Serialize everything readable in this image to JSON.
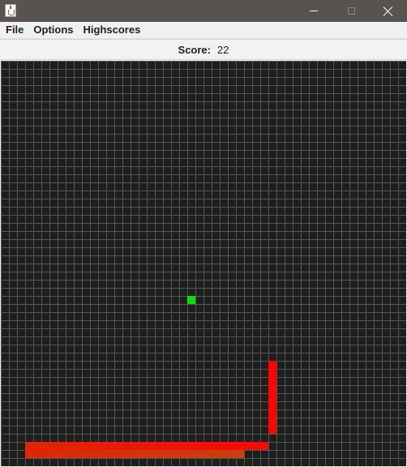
{
  "window": {
    "icon": "java-cup-icon",
    "controls": [
      "minimize-icon",
      "maximize-icon",
      "close-icon"
    ]
  },
  "menu": {
    "items": [
      {
        "label": "File"
      },
      {
        "label": "Options"
      },
      {
        "label": "Highscores"
      }
    ]
  },
  "score": {
    "label": "Score:",
    "value": "22"
  },
  "board": {
    "columns": 50,
    "rows": 50,
    "background_color": "#1e1e1e",
    "grid_color": "#555555",
    "food": {
      "col": 23,
      "row": 29,
      "color": "#00e000"
    },
    "snake": {
      "head_color": "#ff0000",
      "tail_color": "#c9400b",
      "segments": [
        [
          33,
          37
        ],
        [
          33,
          38
        ],
        [
          33,
          39
        ],
        [
          33,
          40
        ],
        [
          33,
          41
        ],
        [
          33,
          42
        ],
        [
          33,
          43
        ],
        [
          33,
          44
        ],
        [
          33,
          45
        ],
        [
          32,
          47
        ],
        [
          31,
          47
        ],
        [
          30,
          47
        ],
        [
          29,
          47
        ],
        [
          28,
          47
        ],
        [
          27,
          47
        ],
        [
          26,
          47
        ],
        [
          25,
          47
        ],
        [
          24,
          47
        ],
        [
          23,
          47
        ],
        [
          22,
          47
        ],
        [
          21,
          47
        ],
        [
          20,
          47
        ],
        [
          19,
          47
        ],
        [
          18,
          47
        ],
        [
          17,
          47
        ],
        [
          16,
          47
        ],
        [
          15,
          47
        ],
        [
          14,
          47
        ],
        [
          13,
          47
        ],
        [
          12,
          47
        ],
        [
          11,
          47
        ],
        [
          10,
          47
        ],
        [
          9,
          47
        ],
        [
          8,
          47
        ],
        [
          7,
          47
        ],
        [
          6,
          47
        ],
        [
          5,
          47
        ],
        [
          4,
          47
        ],
        [
          3,
          47
        ],
        [
          3,
          48
        ],
        [
          4,
          48
        ],
        [
          5,
          48
        ],
        [
          6,
          48
        ],
        [
          7,
          48
        ],
        [
          8,
          48
        ],
        [
          9,
          48
        ],
        [
          10,
          48
        ],
        [
          11,
          48
        ],
        [
          12,
          48
        ],
        [
          13,
          48
        ],
        [
          14,
          48
        ],
        [
          15,
          48
        ],
        [
          16,
          48
        ],
        [
          17,
          48
        ],
        [
          18,
          48
        ],
        [
          19,
          48
        ],
        [
          20,
          48
        ],
        [
          21,
          48
        ],
        [
          22,
          48
        ],
        [
          23,
          48
        ],
        [
          24,
          48
        ],
        [
          25,
          48
        ],
        [
          26,
          48
        ],
        [
          27,
          48
        ],
        [
          28,
          48
        ],
        [
          29,
          48
        ]
      ]
    }
  }
}
